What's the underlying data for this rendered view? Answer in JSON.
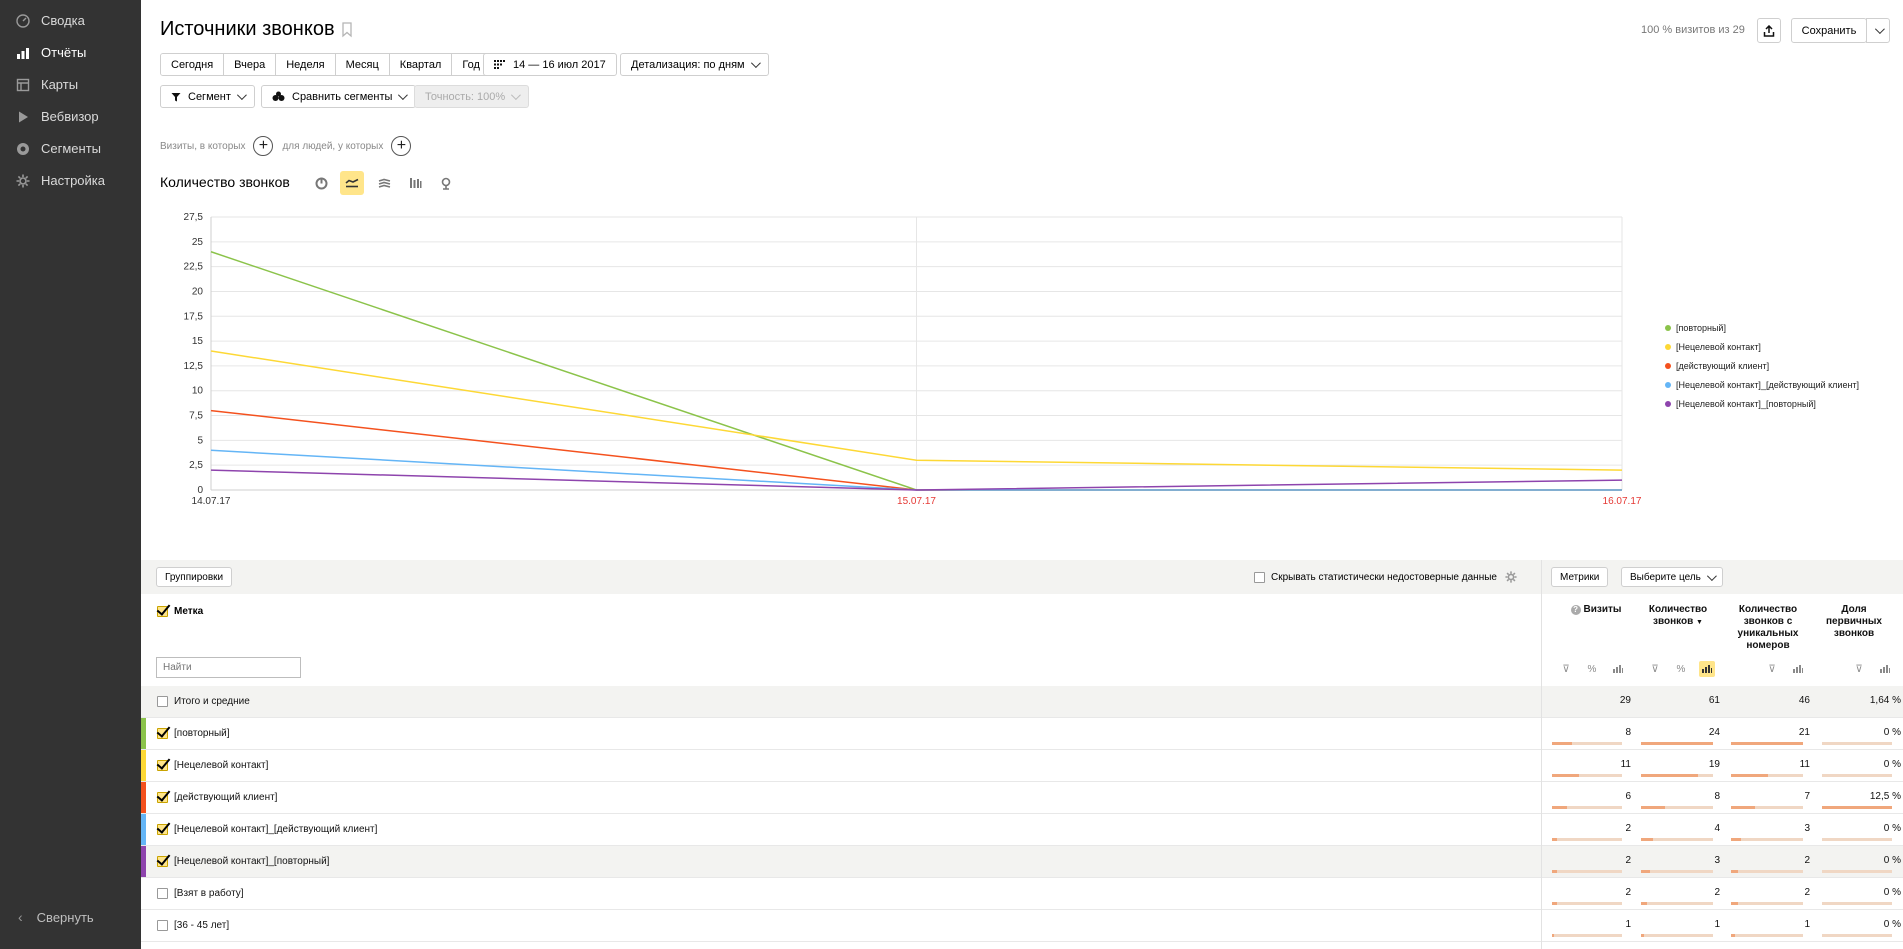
{
  "sidebar": {
    "items": [
      {
        "label": "Сводка",
        "icon": "gauge-icon"
      },
      {
        "label": "Отчёты",
        "icon": "bar-chart-icon"
      },
      {
        "label": "Карты",
        "icon": "map-icon"
      },
      {
        "label": "Вебвизор",
        "icon": "play-icon"
      },
      {
        "label": "Сегменты",
        "icon": "pie-icon"
      },
      {
        "label": "Настройка",
        "icon": "gear-icon"
      }
    ],
    "collapse_label": "Свернуть"
  },
  "header": {
    "title": "Источники звонков",
    "visits_info": "100 % визитов из 29",
    "save_label": "Сохранить"
  },
  "period": {
    "presets": [
      "Сегодня",
      "Вчера",
      "Неделя",
      "Месяц",
      "Квартал",
      "Год"
    ],
    "date_range": "14 — 16 июл 2017",
    "detail": "Детализация: по дням"
  },
  "segments": {
    "segment_label": "Сегмент",
    "compare_label": "Сравнить сегменты",
    "accuracy_label": "Точность: 100%"
  },
  "filters": {
    "visits_label": "Визиты, в которых",
    "people_label": "для людей, у которых"
  },
  "chart_section": {
    "title": "Количество звонков"
  },
  "chart_data": {
    "type": "line",
    "x": [
      "14.07.17",
      "15.07.17",
      "16.07.17"
    ],
    "x_tick_colors": [
      "#333333",
      "#e53935",
      "#e53935"
    ],
    "ylim": [
      0,
      27.5
    ],
    "yticks": [
      "0",
      "2,5",
      "5",
      "7,5",
      "10",
      "12,5",
      "15",
      "17,5",
      "20",
      "22,5",
      "25",
      "27,5"
    ],
    "grid": true,
    "legend_position": "right",
    "series": [
      {
        "name": "[повторный]",
        "color": "#8bc34a",
        "values": [
          24,
          0,
          0
        ]
      },
      {
        "name": "[Нецелевой контакт]",
        "color": "#fdd835",
        "values": [
          14,
          3,
          2
        ]
      },
      {
        "name": "[действующий клиент]",
        "color": "#f4511e",
        "values": [
          8,
          0,
          0
        ]
      },
      {
        "name": "[Нецелевой контакт]_[действующий клиент]",
        "color": "#64b5f6",
        "values": [
          4,
          0,
          0
        ]
      },
      {
        "name": "[Нецелевой контакт]_[повторный]",
        "color": "#8e44ad",
        "values": [
          2,
          0,
          1
        ]
      }
    ]
  },
  "table": {
    "groupings_label": "Группировки",
    "hide_unreliable_label": "Скрывать статистически недостоверные данные",
    "metrics_label": "Метрики",
    "goal_label": "Выберите цель",
    "dimension_header": "Метка",
    "search_placeholder": "Найти",
    "columns": [
      "Визиты",
      "Количество звонков",
      "Количество звонков с уникальных номеров",
      "Доля первичных звонков"
    ],
    "total": {
      "label": "Итого и средние",
      "values": [
        "29",
        "61",
        "46",
        "1,64 %"
      ]
    },
    "rows": [
      {
        "label": "[повторный]",
        "checked": true,
        "color": "#8bc34a",
        "values": [
          "8",
          "24",
          "21",
          "0 %"
        ],
        "shares": [
          0.28,
          1.0,
          1.0,
          0
        ]
      },
      {
        "label": "[Нецелевой контакт]",
        "checked": true,
        "color": "#fdd835",
        "values": [
          "11",
          "19",
          "11",
          "0 %"
        ],
        "shares": [
          0.38,
          0.79,
          0.52,
          0
        ]
      },
      {
        "label": "[действующий клиент]",
        "checked": true,
        "color": "#f4511e",
        "values": [
          "6",
          "8",
          "7",
          "12,5 %"
        ],
        "shares": [
          0.21,
          0.33,
          0.33,
          1.0
        ]
      },
      {
        "label": "[Нецелевой контакт]_[действующий клиент]",
        "checked": true,
        "color": "#64b5f6",
        "values": [
          "2",
          "4",
          "3",
          "0 %"
        ],
        "shares": [
          0.07,
          0.17,
          0.14,
          0
        ]
      },
      {
        "label": "[Нецелевой контакт]_[повторный]",
        "checked": true,
        "color": "#8e44ad",
        "values": [
          "2",
          "3",
          "2",
          "0 %"
        ],
        "shares": [
          0.07,
          0.12,
          0.1,
          0
        ]
      },
      {
        "label": "[Взят в работу]",
        "checked": false,
        "color": "",
        "values": [
          "2",
          "2",
          "2",
          "0 %"
        ],
        "shares": [
          0.07,
          0.08,
          0.1,
          0
        ]
      },
      {
        "label": "[36 - 45 лет]",
        "checked": false,
        "color": "",
        "values": [
          "1",
          "1",
          "1",
          "0 %"
        ],
        "shares": [
          0.03,
          0.04,
          0.05,
          0
        ]
      }
    ]
  }
}
